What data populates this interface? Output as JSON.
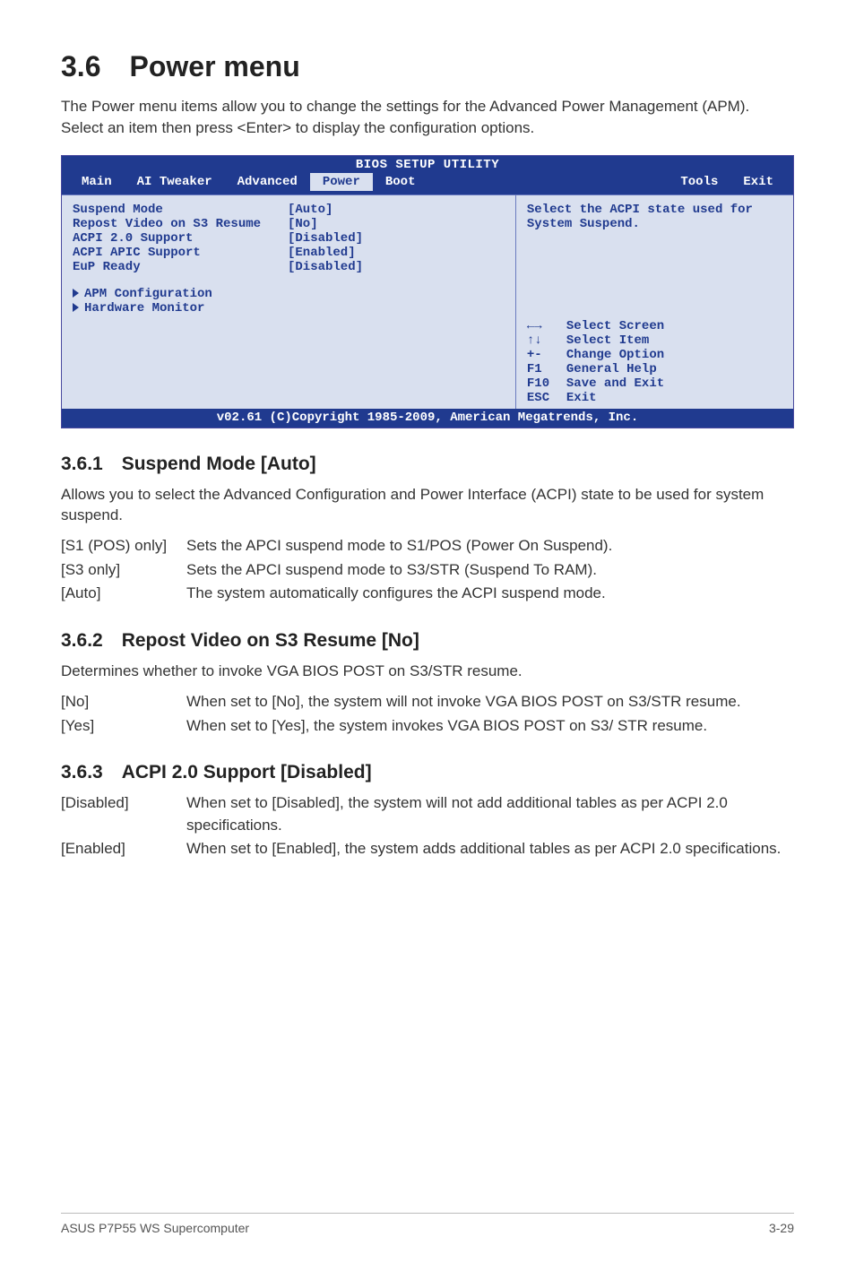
{
  "title": "3.6 Power menu",
  "intro": "The Power menu items allow you to change the settings for the Advanced Power Management (APM). Select an item then press <Enter> to display the configuration options.",
  "bios": {
    "header": "BIOS SETUP UTILITY",
    "tabs": {
      "main": "Main",
      "ai": "AI Tweaker",
      "adv": "Advanced",
      "power": "Power",
      "boot": "Boot",
      "tools": "Tools",
      "exit": "Exit"
    },
    "items": [
      {
        "k": "Suspend Mode",
        "v": "[Auto]"
      },
      {
        "k": "Repost Video on S3 Resume",
        "v": "[No]"
      },
      {
        "k": "ACPI 2.0 Support",
        "v": "[Disabled]"
      },
      {
        "k": "ACPI APIC Support",
        "v": "[Enabled]"
      },
      {
        "k": "EuP Ready",
        "v": "[Disabled]"
      }
    ],
    "sub1": "APM Configuration",
    "sub2": "Hardware Monitor",
    "help_top": "Select the ACPI state used for System Suspend.",
    "helpkeys": [
      {
        "k": "←→",
        "v": "Select Screen"
      },
      {
        "k": "↑↓",
        "v": "Select Item"
      },
      {
        "k": "+-",
        "v": "Change Option"
      },
      {
        "k": "F1",
        "v": "General Help"
      },
      {
        "k": "F10",
        "v": "Save and Exit"
      },
      {
        "k": "ESC",
        "v": "Exit"
      }
    ],
    "footer": "v02.61 (C)Copyright 1985-2009, American Megatrends, Inc."
  },
  "s361": {
    "heading": "3.6.1 Suspend Mode [Auto]",
    "para": "Allows you to select the Advanced Configuration and Power Interface (ACPI) state to be used for system suspend.",
    "opts": [
      {
        "k": "[S1 (POS) only]",
        "v": "Sets the APCI suspend mode to S1/POS (Power On Suspend)."
      },
      {
        "k": "[S3 only]",
        "v": "Sets the APCI suspend mode to S3/STR (Suspend To RAM)."
      },
      {
        "k": "[Auto]",
        "v": "The system automatically configures the ACPI suspend mode."
      }
    ]
  },
  "s362": {
    "heading": "3.6.2 Repost Video on S3 Resume [No]",
    "para": "Determines whether to invoke VGA BIOS POST on S3/STR resume.",
    "opts": [
      {
        "k": "[No]",
        "v": "When set to [No], the system will not invoke VGA BIOS POST on S3/STR resume."
      },
      {
        "k": "[Yes]",
        "v": "When set to [Yes], the system invokes VGA BIOS POST on S3/ STR resume."
      }
    ]
  },
  "s363": {
    "heading": "3.6.3 ACPI 2.0 Support [Disabled]",
    "opts": [
      {
        "k": "[Disabled]",
        "v": "When set to [Disabled], the system will not add additional tables as per ACPI 2.0 specifications."
      },
      {
        "k": "[Enabled]",
        "v": "When set to [Enabled], the system adds additional tables as per ACPI 2.0 specifications."
      }
    ]
  },
  "footer": {
    "left": "ASUS P7P55 WS Supercomputer",
    "right": "3-29"
  }
}
